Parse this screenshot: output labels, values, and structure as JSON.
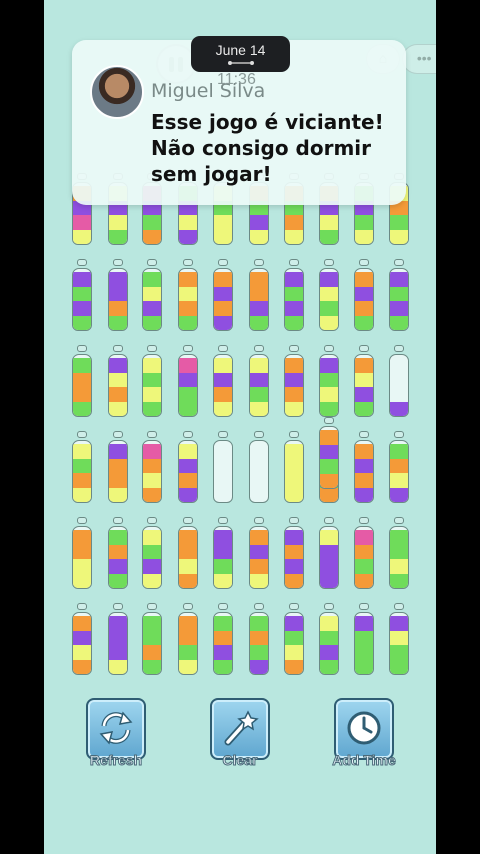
{
  "notification": {
    "sender": "Miguel Silva",
    "message": "Esse jogo é viciante! Não consigo dormir sem jogar!"
  },
  "status": {
    "date": "June 14",
    "time": "11:36"
  },
  "top_bar": {
    "pause_icon": "pause-icon",
    "home_icon": "home-icon",
    "menu_icon": "more-dots-icon",
    "close_icon": "close-icon"
  },
  "colors": {
    "background": "#b9e7df",
    "purple": "#8f4fe0",
    "green": "#6fdc5a",
    "yellow": "#eef77a",
    "orange": "#f49a38",
    "pink": "#e55ba6",
    "light_purple": "#b88ef0"
  },
  "board": {
    "rows": [
      [
        [
          "orange",
          "purple",
          "pink",
          "yellow"
        ],
        [
          "yellow",
          "purple",
          "yellow",
          "green"
        ],
        [
          "pink",
          "purple",
          "green",
          "orange"
        ],
        [
          "green",
          "purple",
          "yellow",
          "purple"
        ],
        [
          "yellow",
          "green",
          "yellow",
          "yellow"
        ],
        [
          "orange",
          "green",
          "purple",
          "yellow"
        ],
        [
          "orange",
          "green",
          "orange",
          "yellow"
        ],
        [
          "orange",
          "purple",
          "yellow",
          "green"
        ],
        [
          "green",
          "purple",
          "green",
          "yellow"
        ],
        [
          "yellow",
          "orange",
          "green",
          "yellow"
        ]
      ],
      [
        [
          "purple",
          "green",
          "purple",
          "green"
        ],
        [
          "purple",
          "purple",
          "orange",
          "green"
        ],
        [
          "green",
          "yellow",
          "purple",
          "green"
        ],
        [
          "orange",
          "yellow",
          "orange",
          "green"
        ],
        [
          "orange",
          "purple",
          "orange",
          "purple"
        ],
        [
          "orange",
          "orange",
          "purple",
          "green"
        ],
        [
          "purple",
          "green",
          "purple",
          "green"
        ],
        [
          "purple",
          "yellow",
          "green",
          "yellow"
        ],
        [
          "orange",
          "purple",
          "orange",
          "green"
        ],
        [
          "purple",
          "green",
          "purple",
          "green"
        ]
      ],
      [
        [
          "green",
          "orange",
          "orange",
          "green"
        ],
        [
          "purple",
          "yellow",
          "orange",
          "yellow"
        ],
        [
          "yellow",
          "green",
          "yellow",
          "green"
        ],
        [
          "pink",
          "purple",
          "green",
          "green"
        ],
        [
          "yellow",
          "purple",
          "orange",
          "yellow"
        ],
        [
          "yellow",
          "purple",
          "green",
          "yellow"
        ],
        [
          "orange",
          "purple",
          "orange",
          "yellow"
        ],
        [
          "purple",
          "green",
          "yellow",
          "green"
        ],
        [
          "orange",
          "yellow",
          "purple",
          "green"
        ],
        [
          "purple"
        ]
      ],
      [
        [
          "yellow",
          "green",
          "orange",
          "yellow"
        ],
        [
          "purple",
          "orange",
          "orange",
          "yellow"
        ],
        [
          "pink",
          "orange",
          "yellow",
          "orange"
        ],
        [
          "yellow",
          "purple",
          "orange",
          "purple"
        ],
        [],
        [],
        [
          "yellow",
          "yellow",
          "yellow",
          "yellow"
        ],
        [
          "purple",
          "yellow",
          "green",
          "orange"
        ],
        [
          "orange",
          "purple",
          "orange",
          "purple"
        ],
        [
          "green",
          "orange",
          "yellow",
          "purple"
        ]
      ],
      [
        [
          "orange",
          "orange",
          "yellow",
          "yellow"
        ],
        [
          "green",
          "orange",
          "purple",
          "green"
        ],
        [
          "yellow",
          "green",
          "purple",
          "yellow"
        ],
        [
          "orange",
          "orange",
          "yellow",
          "orange"
        ],
        [
          "purple",
          "purple",
          "green",
          "yellow"
        ],
        [
          "orange",
          "purple",
          "orange",
          "yellow"
        ],
        [
          "purple",
          "orange",
          "purple",
          "orange"
        ],
        [
          "yellow",
          "purple",
          "purple",
          "purple"
        ],
        [
          "pink",
          "orange",
          "green",
          "orange"
        ],
        [
          "green",
          "green",
          "yellow",
          "green"
        ]
      ],
      [
        [
          "orange",
          "purple",
          "yellow",
          "orange"
        ],
        [
          "purple",
          "purple",
          "purple",
          "yellow"
        ],
        [
          "green",
          "green",
          "orange",
          "green"
        ],
        [
          "orange",
          "orange",
          "green",
          "yellow"
        ],
        [
          "green",
          "orange",
          "purple",
          "green"
        ],
        [
          "green",
          "orange",
          "green",
          "purple"
        ],
        [
          "purple",
          "green",
          "yellow",
          "orange"
        ],
        [
          "yellow",
          "green",
          "purple",
          "green"
        ],
        [
          "purple",
          "green",
          "green",
          "green"
        ],
        [
          "purple",
          "yellow",
          "green",
          "green"
        ]
      ]
    ]
  },
  "lifted_bottle": [
    "orange",
    "purple",
    "green",
    "orange"
  ],
  "dock": [
    {
      "label": "Refresh",
      "icon": "refresh-icon"
    },
    {
      "label": "Clear",
      "icon": "magic-wand-icon"
    },
    {
      "label": "Add Time",
      "icon": "clock-icon"
    }
  ]
}
